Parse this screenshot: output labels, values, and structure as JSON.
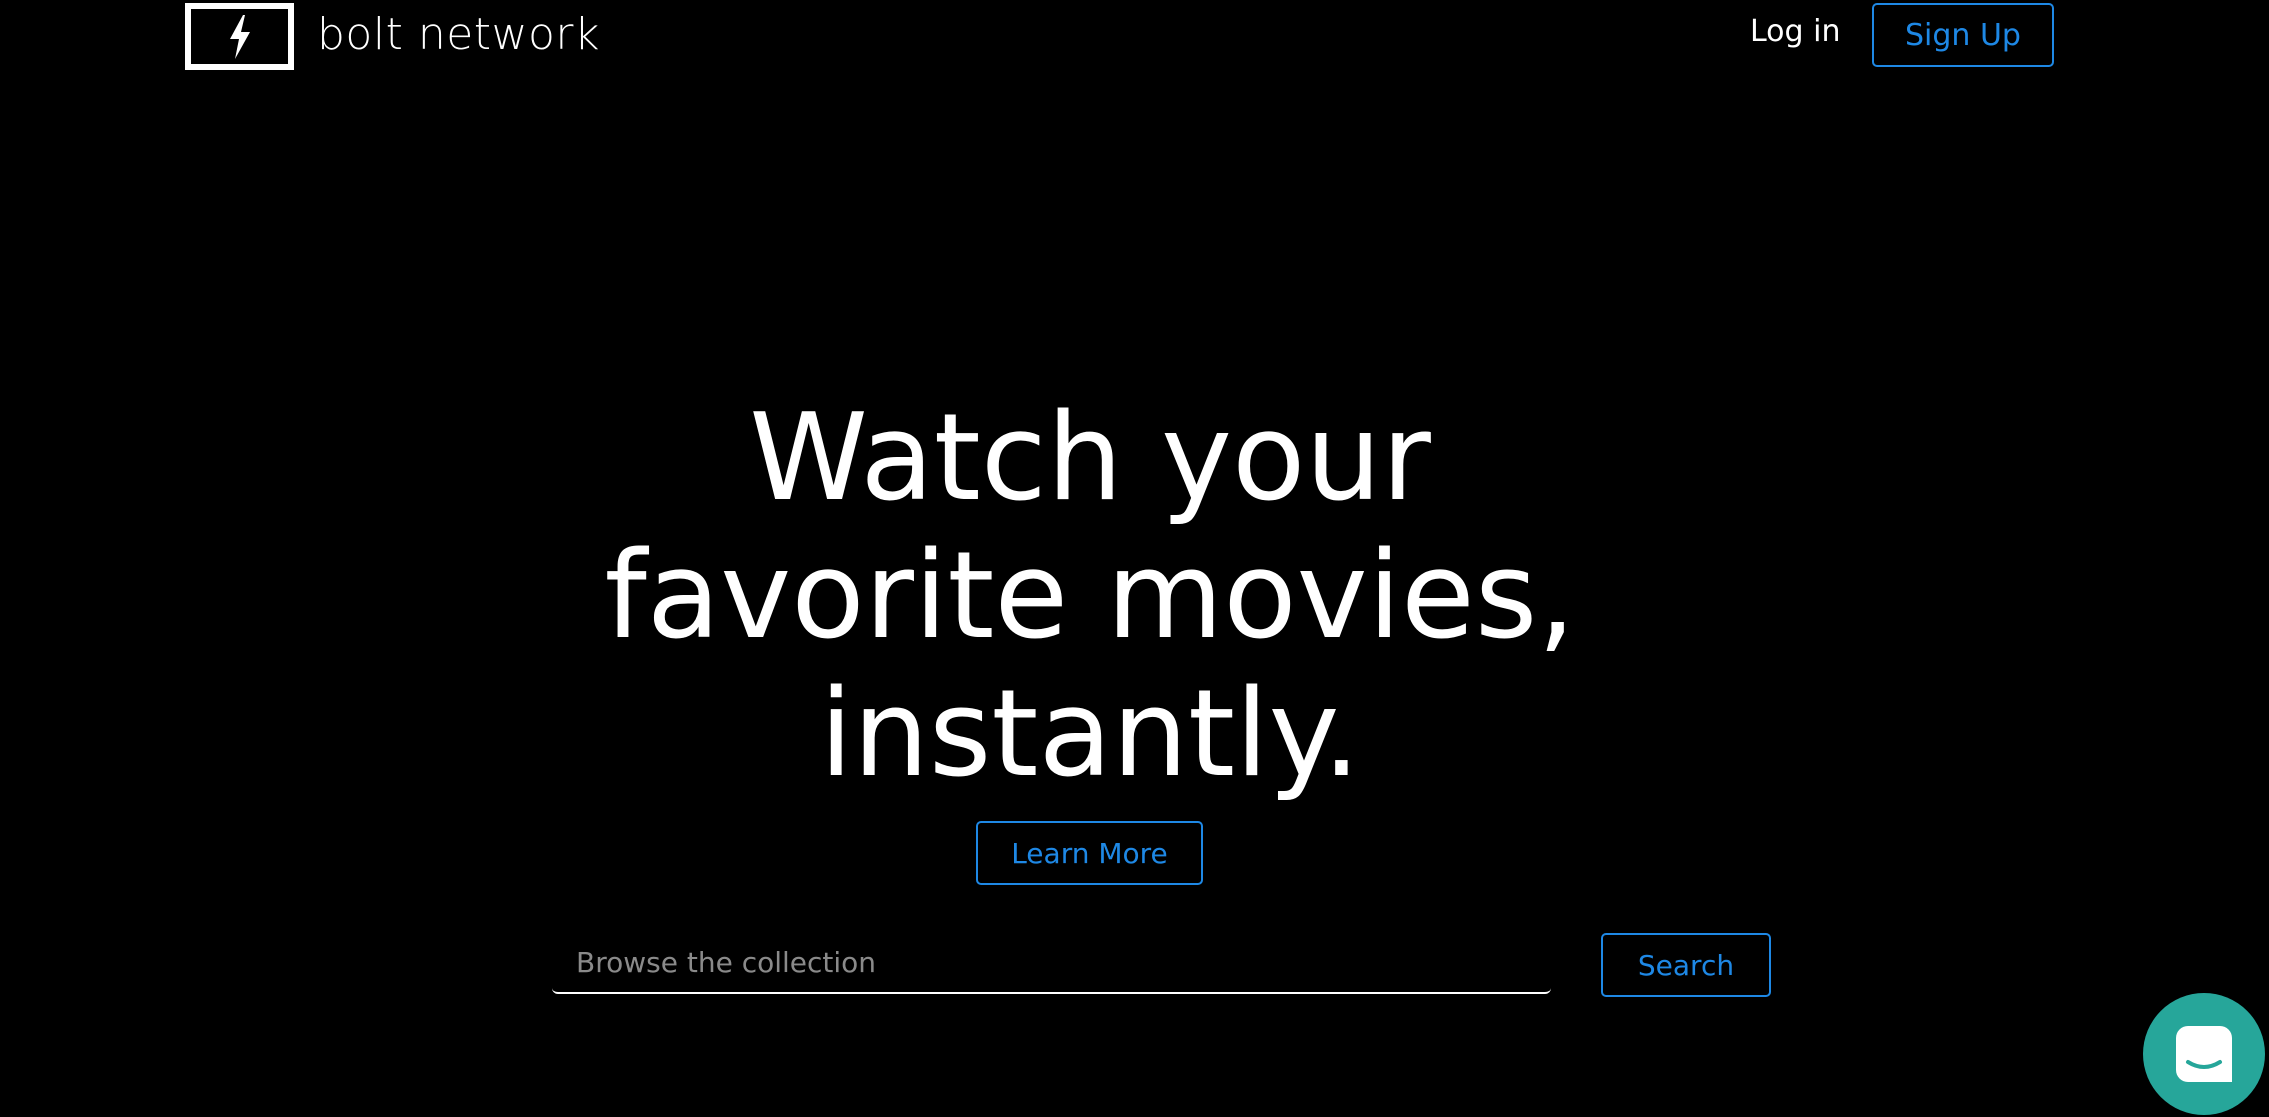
{
  "header": {
    "brand_name": "bolt network",
    "logo_icon": "lightning-bolt-icon",
    "login_label": "Log in",
    "signup_label": "Sign Up"
  },
  "hero": {
    "title_line_1": "Watch your",
    "title_line_2": "favorite movies,",
    "title_line_3": "instantly.",
    "learn_more_label": "Learn More"
  },
  "search": {
    "placeholder": "Browse the collection",
    "value": "",
    "button_label": "Search"
  },
  "chat": {
    "icon": "chat-bubble-icon"
  },
  "colors": {
    "background": "#000000",
    "accent": "#1e88e5",
    "text": "#ffffff",
    "chat_launcher": "#26a69a"
  }
}
